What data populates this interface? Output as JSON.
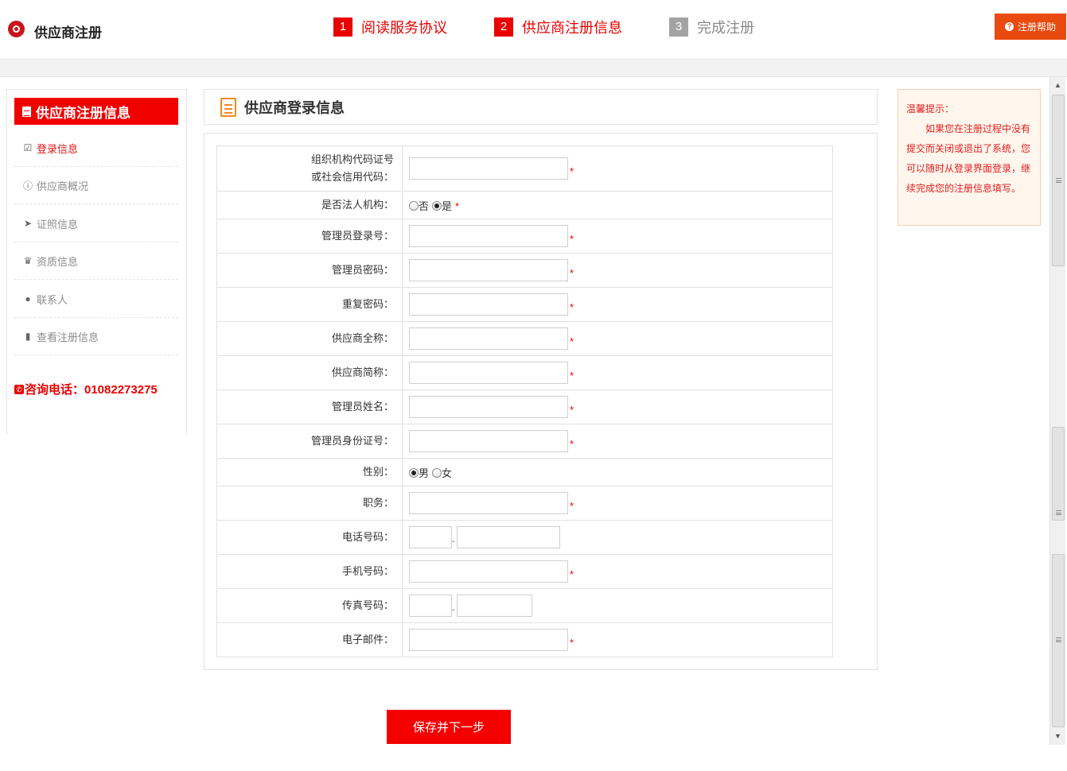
{
  "header": {
    "title": "供应商注册",
    "help_label": "注册帮助",
    "steps": [
      {
        "num": "1",
        "label": "阅读服务协议"
      },
      {
        "num": "2",
        "label": "供应商注册信息"
      },
      {
        "num": "3",
        "label": "完成注册"
      }
    ]
  },
  "sidebar": {
    "heading": "供应商注册信息",
    "items": [
      {
        "label": "登录信息",
        "icon": "check-square-icon"
      },
      {
        "label": "供应商概况",
        "icon": "info-circle-icon"
      },
      {
        "label": "证照信息",
        "icon": "paper-plane-icon"
      },
      {
        "label": "资质信息",
        "icon": "trophy-icon"
      },
      {
        "label": "联系人",
        "icon": "user-icon"
      },
      {
        "label": "查看注册信息",
        "icon": "bookmark-icon"
      }
    ],
    "phone": "咨询电话：01082273275"
  },
  "main": {
    "section_title": "供应商登录信息",
    "fields": {
      "org_code_line1": "组织机构代码证号",
      "org_code_line2": "或社会信用代码：",
      "legal_entity": "是否法人机构：",
      "legal_no": "否",
      "legal_yes": "是",
      "admin_login": "管理员登录号：",
      "admin_password": "管理员密码：",
      "repeat_password": "重复密码：",
      "full_name": "供应商全称：",
      "short_name": "供应商简称：",
      "admin_name": "管理员姓名：",
      "admin_id": "管理员身份证号：",
      "gender": "性别：",
      "gender_male": "男",
      "gender_female": "女",
      "position": "职务：",
      "telephone": "电话号码：",
      "mobile": "手机号码：",
      "fax": "传真号码：",
      "email": "电子邮件："
    },
    "required_mark": "*",
    "submit_label": "保存并下一步"
  },
  "tip": {
    "title": "温馨提示：",
    "body": "如果您在注册过程中没有提交而关闭或退出了系统，您可以随时从登录界面登录，继续完成您的注册信息填写。"
  },
  "colors": {
    "accent": "#f20000",
    "help": "#e84a10",
    "inactive_step": "#a3a3a3"
  }
}
